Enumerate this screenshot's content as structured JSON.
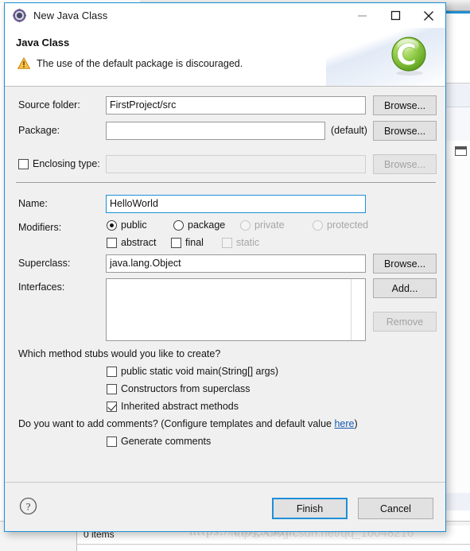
{
  "window": {
    "title": "New Java Class",
    "icon": "java-class-wizard-icon",
    "minimize_label": "—",
    "maximize_label": "□",
    "close_label": "✕"
  },
  "header": {
    "title": "Java Class",
    "message": "The use of the default package is discouraged.",
    "message_icon": "warning-icon",
    "logo": "eclipse-java-wizard-logo"
  },
  "form": {
    "source_folder": {
      "label": "Source folder:",
      "value": "FirstProject/src",
      "placeholder": "",
      "browse_label": "Browse..."
    },
    "package": {
      "label": "Package:",
      "value": "",
      "placeholder": "",
      "suffix": "(default)",
      "browse_label": "Browse..."
    },
    "enclosing_type": {
      "label": "Enclosing type:",
      "checked": false,
      "value": "",
      "browse_label": "Browse...",
      "disabled": true
    },
    "name": {
      "label": "Name:",
      "value": "HelloWorld",
      "placeholder": ""
    },
    "modifiers": {
      "label": "Modifiers:",
      "access": [
        {
          "label": "public",
          "selected": true,
          "disabled": false
        },
        {
          "label": "package",
          "selected": false,
          "disabled": false
        },
        {
          "label": "private",
          "selected": false,
          "disabled": true
        },
        {
          "label": "protected",
          "selected": false,
          "disabled": true
        }
      ],
      "flags": [
        {
          "label": "abstract",
          "checked": false,
          "disabled": false
        },
        {
          "label": "final",
          "checked": false,
          "disabled": false
        },
        {
          "label": "static",
          "checked": false,
          "disabled": true
        }
      ]
    },
    "superclass": {
      "label": "Superclass:",
      "value": "java.lang.Object",
      "browse_label": "Browse..."
    },
    "interfaces": {
      "label": "Interfaces:",
      "items": [],
      "add_label": "Add...",
      "remove_label": "Remove",
      "remove_disabled": true
    }
  },
  "stubs": {
    "question": "Which method stubs would you like to create?",
    "options": [
      {
        "label": "public static void main(String[] args)",
        "checked": false
      },
      {
        "label": "Constructors from superclass",
        "checked": false
      },
      {
        "label": "Inherited abstract methods",
        "checked": true
      }
    ]
  },
  "comments": {
    "question_prefix": "Do you want to add comments? (Configure templates and default value ",
    "link_label": "here",
    "question_suffix": ")",
    "option": {
      "label": "Generate comments",
      "checked": false
    }
  },
  "footer": {
    "help_icon": "help-question-icon",
    "finish_label": "Finish",
    "cancel_label": "Cancel"
  },
  "background": {
    "items_status": "0 items",
    "watermark_primary": "https://blog.csdn.",
    "watermark_secondary": "https://blog.csdn.net/qq_16048216"
  },
  "colors": {
    "dialog_border": "#1e8fd6",
    "accent": "#1e8fd6",
    "dialog_bg": "#f0f0f0",
    "link": "#1559b5",
    "warning": "#f0ad2e",
    "logo_green": "#8cc63f"
  }
}
